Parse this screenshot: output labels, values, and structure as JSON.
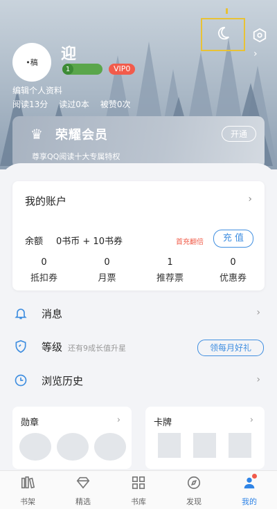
{
  "profile": {
    "name": "迎",
    "avatar_text": "•稿",
    "level_number": "1",
    "vip_badge": "VIP0",
    "edit_link": "编辑个人资料",
    "stats": [
      "阅读13分",
      "读过0本",
      "被赞0次"
    ]
  },
  "vip_card": {
    "title": "荣耀会员",
    "subtitle": "尊享QQ阅读十大专属特权",
    "open_button": "开通"
  },
  "account": {
    "title": "我的账户",
    "balance_label": "余额",
    "balance_value": "0书币 + 10书券",
    "promo": "首充翻倍",
    "recharge_button": "充 值",
    "coupons": [
      {
        "count": "0",
        "label": "抵扣券"
      },
      {
        "count": "0",
        "label": "月票"
      },
      {
        "count": "1",
        "label": "推荐票"
      },
      {
        "count": "0",
        "label": "优惠券"
      }
    ]
  },
  "menu": {
    "messages": "消息",
    "level": "等级",
    "level_hint": "还有9成长值升星",
    "level_gift_button": "领每月好礼",
    "history": "浏览历史"
  },
  "cards": {
    "medals": "勋章",
    "cards": "卡牌"
  },
  "tabs": [
    {
      "label": "书架",
      "icon": "bookshelf-icon"
    },
    {
      "label": "精选",
      "icon": "diamond-icon"
    },
    {
      "label": "书库",
      "icon": "grid-icon"
    },
    {
      "label": "发现",
      "icon": "compass-icon"
    },
    {
      "label": "我的",
      "icon": "person-icon"
    }
  ],
  "colors": {
    "accent": "#2f84e6",
    "vip_badge": "#f25b4b",
    "promo": "#f05a47",
    "level_badge": "#5aa64b"
  }
}
